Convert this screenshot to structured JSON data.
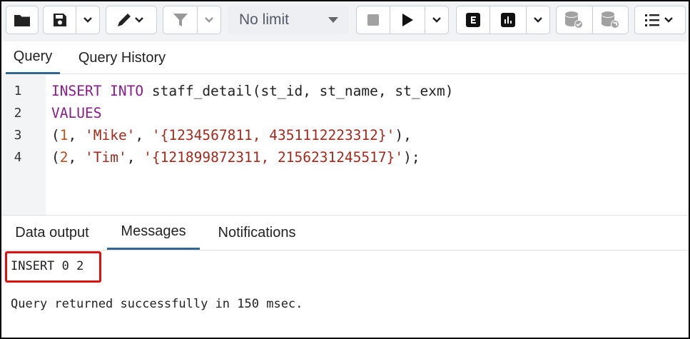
{
  "toolbar": {
    "limit_select": {
      "value": "No limit"
    },
    "icons": [
      "folder-icon",
      "save-icon",
      "chevron-down-icon",
      "edit-pen-icon",
      "filter-icon",
      "stop-icon",
      "play-icon",
      "explain-icon",
      "explain-analyze-icon",
      "commit-icon",
      "rollback-icon",
      "macros-list-icon"
    ]
  },
  "query_tabs": [
    {
      "label": "Query",
      "active": true
    },
    {
      "label": "Query History",
      "active": false
    }
  ],
  "editor": {
    "line_numbers": [
      "1",
      "2",
      "3",
      "4"
    ],
    "tokens": {
      "l1_kw": "INSERT INTO",
      "l1_rest": " staff_detail(st_id, st_name, st_exm)",
      "l2_kw": "VALUES",
      "l3_open": "(",
      "l3_num": "1",
      "l3_sep1": ", ",
      "l3_str1": "'Mike'",
      "l3_sep2": ", ",
      "l3_str2": "'{1234567811, 4351112223312}'",
      "l3_close": "),",
      "l4_open": "(",
      "l4_num": "2",
      "l4_sep1": ", ",
      "l4_str1": "'Tim'",
      "l4_sep2": ", ",
      "l4_str2": "'{121899872311, 2156231245517}'",
      "l4_close": ");"
    }
  },
  "output_tabs": [
    {
      "label": "Data output",
      "active": false
    },
    {
      "label": "Messages",
      "active": true
    },
    {
      "label": "Notifications",
      "active": false
    }
  ],
  "messages": {
    "result": "INSERT 0 2",
    "status": "Query returned successfully in 150 msec."
  },
  "colors": {
    "keyword": "#8a1c8a",
    "string": "#a12a1c",
    "number": "#b5511a",
    "active_tab": "#326690",
    "highlight_box": "#e01010"
  }
}
